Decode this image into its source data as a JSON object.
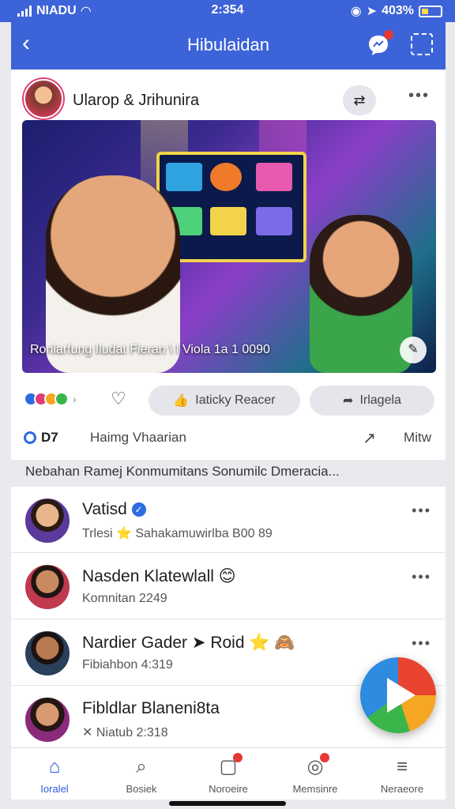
{
  "status_bar": {
    "carrier": "NIADU",
    "time": "2:354",
    "battery": "403%"
  },
  "app_bar": {
    "title": "Hibulaidan"
  },
  "post": {
    "author": "Ularop & Jrihunira",
    "image_caption": "Ronlarfung Iludat Fieran \\ l Viola 1a 1 0090",
    "actions": {
      "like_label": "Iaticky Reacer",
      "share_label": "Irlagela"
    },
    "stats": {
      "count": "D7",
      "label": "Haimg Vhaarian",
      "more_label": "Mitw"
    }
  },
  "section_header": "Nebahan Ramej Konmumitans Sonumilc Dmeracia...",
  "members": [
    {
      "name": "Vatisd",
      "subtitle": "Trlesi ⭐ Sahakamuwirlba B00 89",
      "verified": true
    },
    {
      "name": "Nasden Klatewlall 😊",
      "subtitle": "Komnitan 2249",
      "verified": false
    },
    {
      "name": "Nardier Gader ➤ Roid ⭐ 🙈",
      "subtitle": "Fibiahbon 4:319",
      "verified": false
    },
    {
      "name": "Fibldlar Blaneni8ta",
      "subtitle": "✕ Niatub 2:318",
      "verified": false
    }
  ],
  "tabs": [
    {
      "label": "Ioralel",
      "icon": "home-icon",
      "active": true
    },
    {
      "label": "Bosiek",
      "icon": "search-icon",
      "active": false
    },
    {
      "label": "Noroeire",
      "icon": "notifications-icon",
      "active": false,
      "badge": true
    },
    {
      "label": "Memsinre",
      "icon": "compass-icon",
      "active": false,
      "badge": true
    },
    {
      "label": "Neraeore",
      "icon": "menu-icon",
      "active": false
    }
  ],
  "colors": {
    "primary": "#3d63d8",
    "accent": "#2d6be0",
    "badge": "#e53935"
  }
}
